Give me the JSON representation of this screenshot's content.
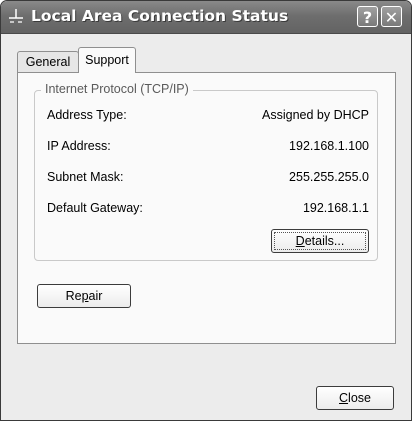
{
  "window": {
    "title": "Local Area Connection Status",
    "help_glyph": "?",
    "close_glyph": "✕"
  },
  "tabs": [
    {
      "label": "General",
      "selected": false
    },
    {
      "label": "Support",
      "selected": true
    }
  ],
  "group": {
    "legend": "Internet Protocol (TCP/IP)",
    "rows": [
      {
        "label": "Address Type:",
        "value": "Assigned by DHCP"
      },
      {
        "label": "IP Address:",
        "value": "192.168.1.100"
      },
      {
        "label": "Subnet Mask:",
        "value": "255.255.255.0"
      },
      {
        "label": "Default Gateway:",
        "value": "192.168.1.1"
      }
    ]
  },
  "buttons": {
    "details": {
      "pre": "",
      "mnemonic": "D",
      "post": "etails..."
    },
    "repair": {
      "pre": "Re",
      "mnemonic": "p",
      "post": "air"
    },
    "close": {
      "pre": "",
      "mnemonic": "C",
      "post": "lose"
    }
  },
  "icons": {
    "window_icon": "network-connection-icon"
  }
}
